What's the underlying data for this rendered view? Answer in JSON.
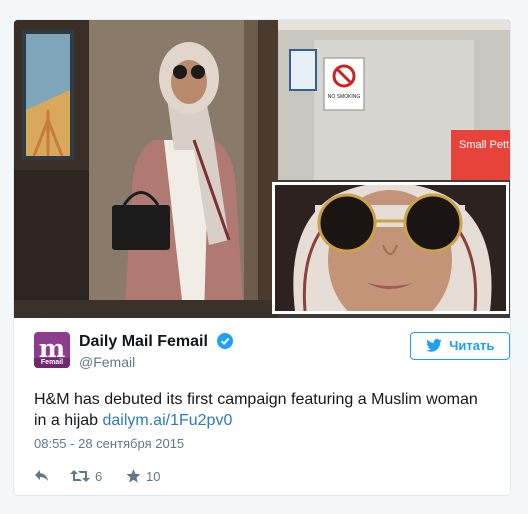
{
  "tweet": {
    "display_name": "Daily Mail Femail",
    "handle": "@Femail",
    "avatar_letter": "m",
    "avatar_sub": "Femail",
    "follow_label": "Читать",
    "text": "H&M has debuted its first campaign featuring a Muslim woman in a hijab ",
    "link": "dailym.ai/1Fu2pv0",
    "timestamp": "08:55 - 28 сентября 2015",
    "retweets": "6",
    "likes": "10"
  },
  "media": {
    "sign_no_smoking": "NO SMOKING",
    "sign_shop": "Small Pett"
  },
  "colors": {
    "accent": "#1da1f2",
    "link": "#2b7bb9",
    "brand": "#8e3d8c",
    "muted": "#657786"
  },
  "icons": [
    "verified-badge-icon",
    "twitter-bird-icon",
    "reply-icon",
    "retweet-icon",
    "like-star-icon"
  ]
}
